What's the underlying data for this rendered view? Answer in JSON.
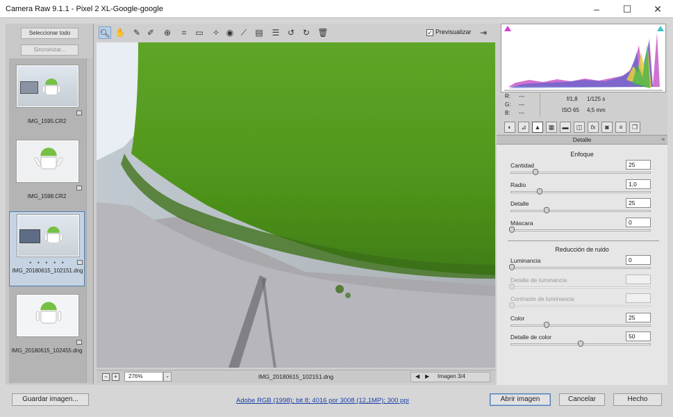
{
  "window": {
    "title": "Camera Raw 9.1.1 -  Pixel 2 XL-Google-google"
  },
  "filmstrip": {
    "select_all": "Seleccionar todo",
    "sync": "Sincronizar...",
    "thumbnails": [
      {
        "name": "IMG_1595.CR2"
      },
      {
        "name": "IMG_1598.CR2"
      },
      {
        "name": "IMG_20180615_102151.dng",
        "rating": "• • • • •"
      },
      {
        "name": "IMG_20180615_102455.dng"
      }
    ]
  },
  "toolbar": {
    "preview_label": "Previsualizar",
    "preview_checked": "✓"
  },
  "statusbar": {
    "zoom": "276%",
    "filename": "IMG_20180615_102151.dng",
    "image_counter": "Imagen 3/4"
  },
  "readout": {
    "r_label": "R:",
    "g_label": "G:",
    "b_label": "B:",
    "r_value": "---",
    "g_value": "---",
    "b_value": "---",
    "aperture": "f/1,8",
    "shutter": "1/125 s",
    "iso": "ISO 65",
    "focal": "4,5 mm"
  },
  "panel": {
    "title": "Detalle",
    "sharpening": {
      "title": "Enfoque",
      "sliders": [
        {
          "label": "Cantidad",
          "value": "25",
          "position": 0.17
        },
        {
          "label": "Radio",
          "value": "1,0",
          "position": 0.2
        },
        {
          "label": "Detalle",
          "value": "25",
          "position": 0.25
        },
        {
          "label": "Máscara",
          "value": "0",
          "position": 0.0
        }
      ]
    },
    "noise": {
      "title": "Reducción de ruido",
      "sliders": [
        {
          "label": "Luminancia",
          "value": "0",
          "position": 0.0
        },
        {
          "label": "Detalle de luminancia",
          "value": "",
          "position": 0.0,
          "disabled": true
        },
        {
          "label": "Contraste de luminancia",
          "value": "",
          "position": 0.0,
          "disabled": true
        },
        {
          "label": "Color",
          "value": "25",
          "position": 0.25
        },
        {
          "label": "Detalle de color",
          "value": "50",
          "position": 0.5
        }
      ]
    }
  },
  "footer": {
    "save": "Guardar imagen...",
    "workflow_link": "Adobe RGB (1998); bit 8; 4016 por 3008 (12,1MP); 300 ppi",
    "open": "Abrir imagen",
    "cancel": "Cancelar",
    "done": "Hecho"
  },
  "colors": {
    "accent": "#4f7bb0",
    "android_green": "#5a9a1c",
    "link": "#1a3fa6"
  }
}
